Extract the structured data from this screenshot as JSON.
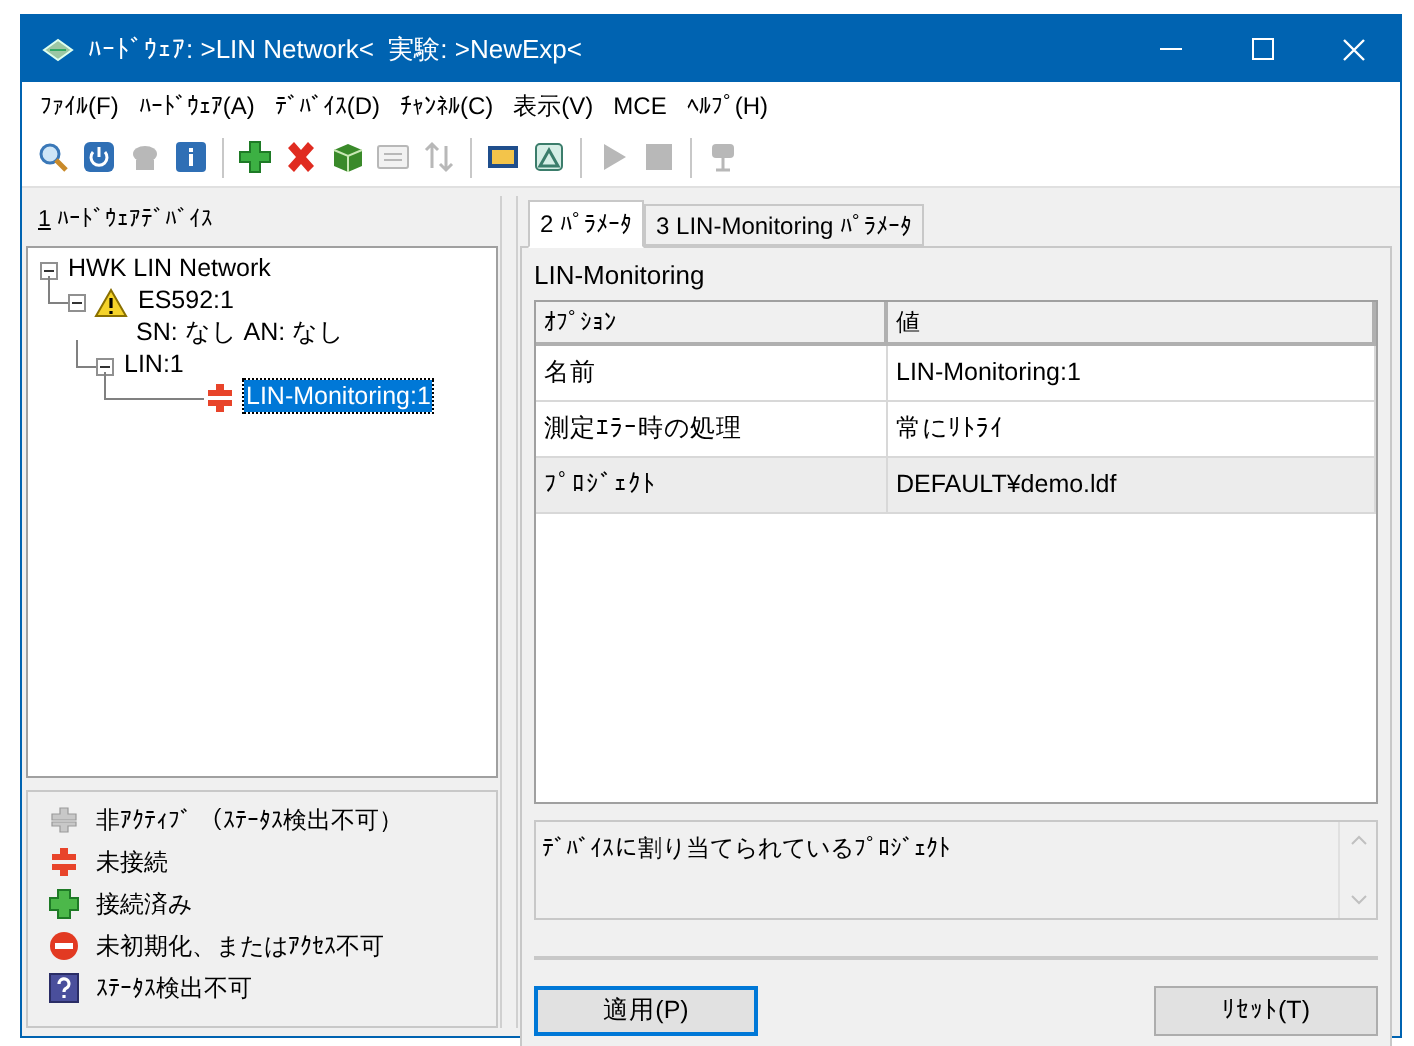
{
  "window": {
    "title": "ﾊｰﾄﾞｳｪｱ: >LIN Network<  実験: >NewExp<"
  },
  "menu": [
    "ﾌｧｲﾙ(F)",
    "ﾊｰﾄﾞｳｪｱ(A)",
    "ﾃﾞﾊﾞｲｽ(D)",
    "ﾁｬﾝﾈﾙ(C)",
    "表示(V)",
    "MCE",
    "ﾍﾙﾌﾟ(H)"
  ],
  "toolbar": [
    [
      {
        "disabled": false
      },
      {
        "disabled": false
      },
      {
        "disabled": true
      },
      {
        "disabled": false
      }
    ],
    [
      {
        "disabled": false
      },
      {
        "disabled": false
      },
      {
        "disabled": false
      },
      {
        "disabled": true
      },
      {
        "disabled": true
      }
    ],
    [
      {
        "disabled": false
      },
      {
        "disabled": false
      }
    ],
    [
      {
        "disabled": true
      },
      {
        "disabled": true
      }
    ],
    [
      {
        "disabled": true
      }
    ]
  ],
  "device_panel": {
    "mnemonic": "1",
    "title": "ﾊｰﾄﾞｳｪｱﾃﾞﾊﾞｲｽ",
    "tree": [
      {
        "label": "HWK LIN Network",
        "expanded": true,
        "selected": false,
        "children": [
          {
            "label": "ES592:1",
            "sublabel": "SN: なし AN: なし",
            "kind": "device",
            "expanded": true,
            "selected": false,
            "children": [
              {
                "label": "LIN:1",
                "expanded": true,
                "selected": false,
                "children": [
                  {
                    "label": "LIN-Monitoring:1",
                    "kind": "monitor",
                    "selected": true
                  }
                ]
              }
            ]
          }
        ]
      }
    ]
  },
  "legend": [
    {
      "kind": "inactive",
      "label": "非ｱｸﾃｨﾌﾞ （ｽﾃｰﾀｽ検出不可）"
    },
    {
      "kind": "disconnected",
      "label": "未接続"
    },
    {
      "kind": "connected",
      "label": "接続済み"
    },
    {
      "kind": "error",
      "label": "未初期化、またはｱｸｾｽ不可"
    },
    {
      "kind": "unknown",
      "label": "ｽﾃｰﾀｽ検出不可"
    }
  ],
  "tabs": [
    {
      "label": "2 ﾊﾟﾗﾒｰﾀ",
      "selected": true
    },
    {
      "label": "3 LIN-Monitoring ﾊﾟﾗﾒｰﾀ",
      "selected": false
    }
  ],
  "section_title": "LIN-Monitoring",
  "table": {
    "columns": [
      "ｵﾌﾟｼｮﾝ",
      "値"
    ],
    "rows": [
      {
        "cells": [
          "名前",
          "LIN-Monitoring:1"
        ],
        "selected": false
      },
      {
        "cells": [
          "測定ｴﾗｰ時の処理",
          "常にﾘﾄﾗｲ"
        ],
        "selected": false
      },
      {
        "cells": [
          "ﾌﾟﾛｼﾞｪｸﾄ",
          "DEFAULT¥demo.ldf"
        ],
        "selected": true
      }
    ]
  },
  "description": "ﾃﾞﾊﾞｲｽに割り当てられているﾌﾟﾛｼﾞｪｸﾄ",
  "buttons": [
    {
      "label": "適用(P)",
      "default": true
    },
    {
      "label": "ﾘｾｯﾄ(T)",
      "default": false
    }
  ]
}
